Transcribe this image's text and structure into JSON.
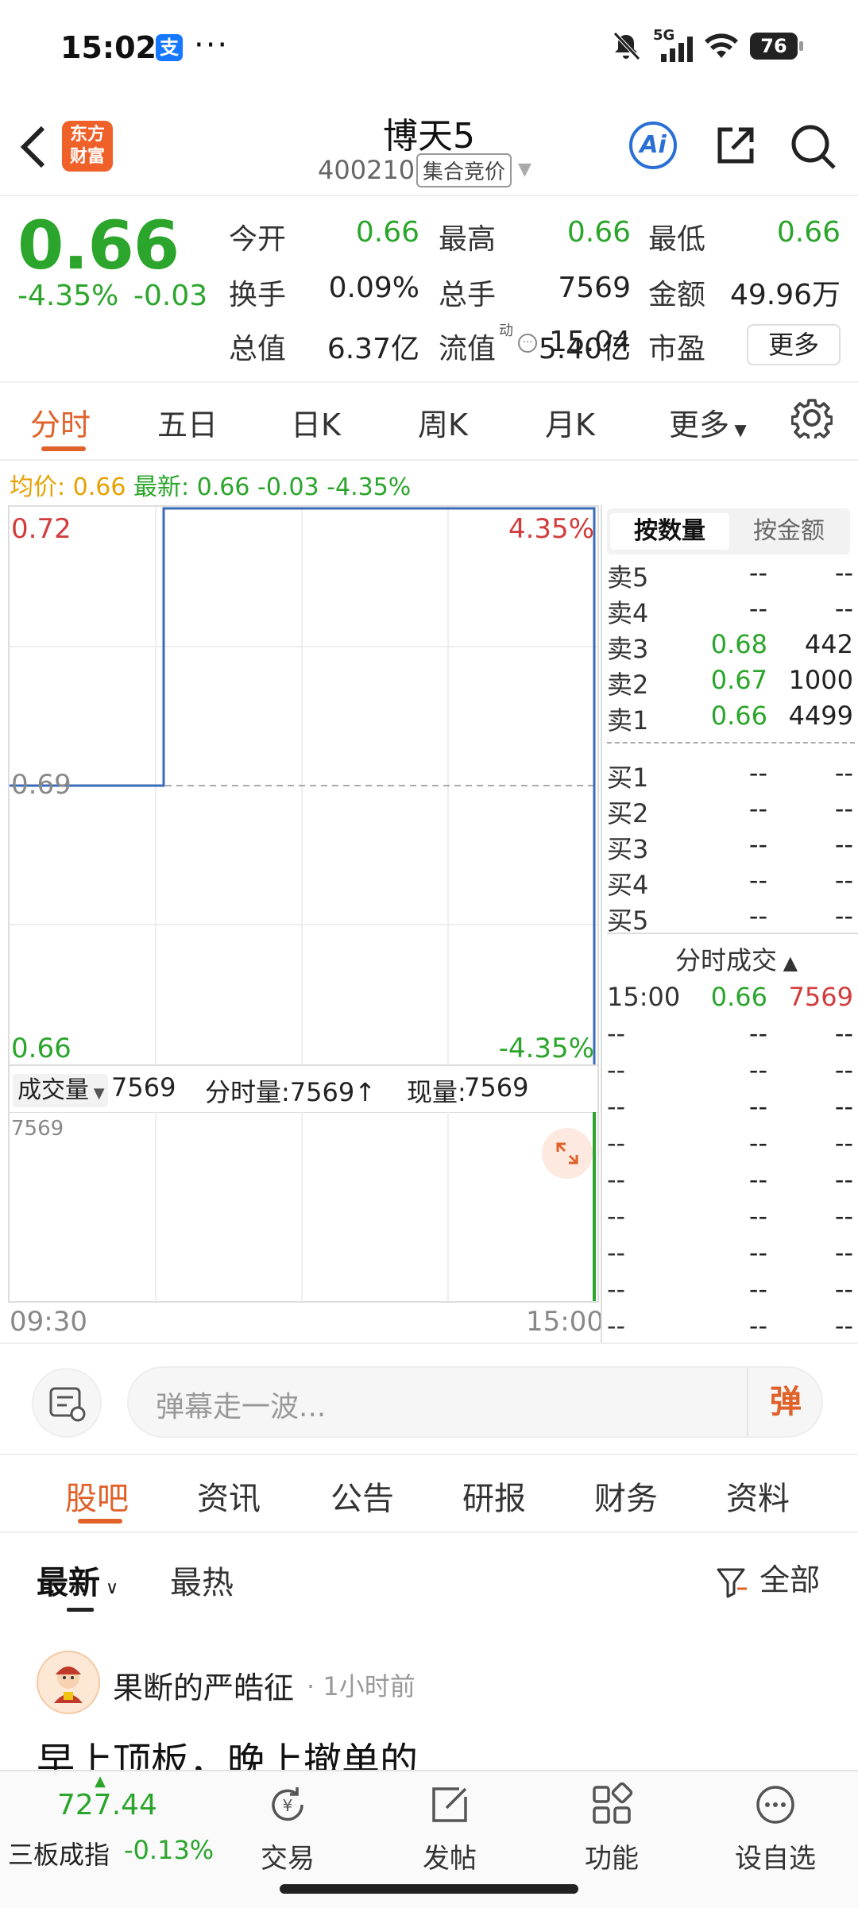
{
  "status_bar": {
    "time": "15:02",
    "pay_icon_text": "支",
    "dots": "···",
    "signal": "5G",
    "battery": "76"
  },
  "header": {
    "stock_name": "博天5",
    "stock_code": "400210",
    "auction_tag": "集合竞价",
    "logo_line1": "东方",
    "logo_line2": "财富",
    "ai_label": "Ai"
  },
  "quote": {
    "price": "0.66",
    "change_pct": "-4.35%",
    "change_abs": "-0.03",
    "fields": [
      {
        "label": "今开",
        "value": "0.66",
        "color": "green"
      },
      {
        "label": "最高",
        "value": "0.66",
        "color": "green"
      },
      {
        "label": "最低",
        "value": "0.66",
        "color": "green"
      },
      {
        "label": "换手",
        "value": "0.09%",
        "color": "black"
      },
      {
        "label": "总手",
        "value": "7569",
        "color": "black"
      },
      {
        "label": "金额",
        "value": "49.96万",
        "color": "black"
      },
      {
        "label": "总值",
        "value": "6.37亿",
        "color": "black"
      },
      {
        "label": "流值",
        "value": "5.40亿",
        "color": "black"
      },
      {
        "label": "市盈",
        "value": "15.04",
        "color": "black"
      }
    ],
    "pe_superscript": "动",
    "more_label": "更多"
  },
  "chart_tabs": [
    "分时",
    "五日",
    "日K",
    "周K",
    "月K",
    "更多"
  ],
  "avg_line": {
    "avg_label": "均价:",
    "avg_value": "0.66",
    "latest_label": "最新:",
    "latest_value": "0.66",
    "latest_change": "-0.03",
    "latest_pct": "-4.35%"
  },
  "chart_data": {
    "type": "line",
    "x": [
      "09:30",
      "15:00"
    ],
    "y_left_ticks": [
      "0.72",
      "0.69",
      "0.66"
    ],
    "y_right_ticks": [
      "4.35%",
      "-4.35%"
    ],
    "volume_max_label": "7569"
  },
  "volume_bar": {
    "selector": "成交量",
    "selector_value": "7569",
    "minute_vol": "分时量:7569↑",
    "current_label": "现量:",
    "current_value": "7569"
  },
  "order_book": {
    "tabs": [
      "按数量",
      "按金额"
    ],
    "asks": [
      {
        "label": "卖5",
        "price": "--",
        "qty": "--"
      },
      {
        "label": "卖4",
        "price": "--",
        "qty": "--"
      },
      {
        "label": "卖3",
        "price": "0.68",
        "qty": "442"
      },
      {
        "label": "卖2",
        "price": "0.67",
        "qty": "1000"
      },
      {
        "label": "卖1",
        "price": "0.66",
        "qty": "4499"
      }
    ],
    "bids": [
      {
        "label": "买1",
        "price": "--",
        "qty": "--"
      },
      {
        "label": "买2",
        "price": "--",
        "qty": "--"
      },
      {
        "label": "买3",
        "price": "--",
        "qty": "--"
      },
      {
        "label": "买4",
        "price": "--",
        "qty": "--"
      },
      {
        "label": "买5",
        "price": "--",
        "qty": "--"
      }
    ],
    "ticks_title": "分时成交",
    "ticks": [
      {
        "time": "15:00",
        "price": "0.66",
        "qty": "7569"
      },
      {
        "time": "--",
        "price": "--",
        "qty": "--"
      },
      {
        "time": "--",
        "price": "--",
        "qty": "--"
      },
      {
        "time": "--",
        "price": "--",
        "qty": "--"
      },
      {
        "time": "--",
        "price": "--",
        "qty": "--"
      },
      {
        "time": "--",
        "price": "--",
        "qty": "--"
      },
      {
        "time": "--",
        "price": "--",
        "qty": "--"
      },
      {
        "time": "--",
        "price": "--",
        "qty": "--"
      },
      {
        "time": "--",
        "price": "--",
        "qty": "--"
      },
      {
        "time": "--",
        "price": "--",
        "qty": "--"
      }
    ]
  },
  "danmaku": {
    "placeholder": "弹幕走一波...",
    "button": "弹"
  },
  "bottom_tabs": [
    "股吧",
    "资讯",
    "公告",
    "研报",
    "财务",
    "资料"
  ],
  "feed": {
    "sort_latest": "最新",
    "sort_hot": "最热",
    "filter_label": "全部",
    "post": {
      "user": "果断的严皓征",
      "time": "· 1小时前",
      "title": "早上顶板，晚上撤单的"
    }
  },
  "bottom_nav": {
    "index_value": "727.44",
    "index_name": "三板成指",
    "index_change": "-0.13%",
    "items": [
      "交易",
      "发帖",
      "功能",
      "设自选"
    ]
  }
}
